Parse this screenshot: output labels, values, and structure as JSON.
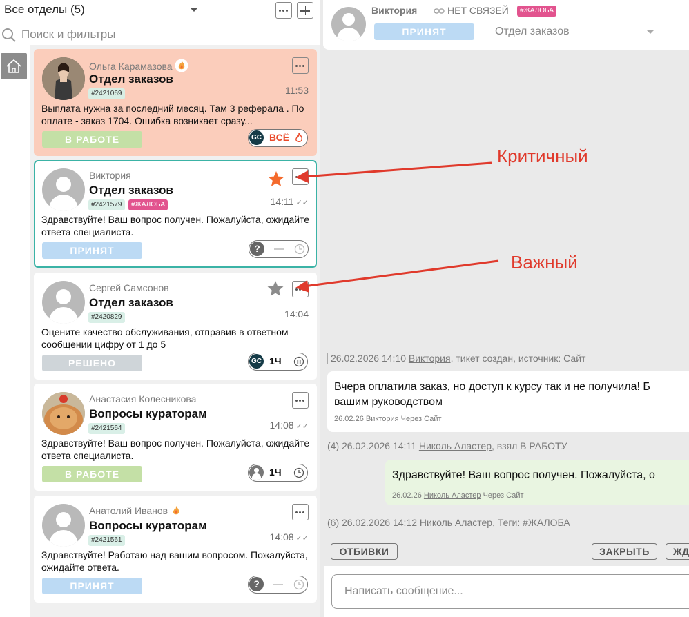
{
  "sidebar": {
    "dept_select": "Все отделы (5)",
    "search_placeholder": "Поиск и фильтры"
  },
  "tickets": [
    {
      "name": "Ольга Карамазова",
      "dept": "Отдел заказов",
      "id": "#2421069",
      "time": "11:53",
      "message": "Выплата нужна за последний месяц. Там 3 реферала . По оплате - заказ 1704. Ошибка возникает сразу...",
      "status": "В РАБОТЕ",
      "pill_badge": "GC",
      "pill_text": "ВСЁ",
      "hot": true,
      "bg_color": "#fbcdbb"
    },
    {
      "name": "Виктория",
      "dept": "Отдел заказов",
      "id": "#2421579",
      "tag": "#ЖАЛОБА",
      "time": "14:11",
      "message": "Здравствуйте! Ваш вопрос получен. Пожалуйста, ожидайте ответа специалиста.",
      "status": "ПРИНЯТ",
      "pill_badge": "?",
      "star_color": "#f46a2c",
      "selected": true
    },
    {
      "name": "Сергей Самсонов",
      "dept": "Отдел заказов",
      "id": "#2420829",
      "time": "14:04",
      "message": "Оцените качество обслуживания, отправив в ответном сообщении цифру от 1 до 5",
      "status": "РЕШЕНО",
      "pill_badge": "GC",
      "pill_text": "1Ч",
      "star_color": "#8c8c8c"
    },
    {
      "name": "Анастасия Колесникова",
      "dept": "Вопросы кураторам",
      "id": "#2421564",
      "time": "14:08",
      "message": "Здравствуйте! Ваш вопрос получен. Пожалуйста, ожидайте ответа специалиста.",
      "status": "В РАБОТЕ",
      "pill_text": "1Ч"
    },
    {
      "name": "Анатолий Иванов",
      "dept": "Вопросы кураторам",
      "id": "#2421561",
      "time": "14:08",
      "message": "Здравствуйте! Работаю над вашим вопросом. Пожалуйста, ожидайте ответа.",
      "status": "ПРИНЯТ",
      "pill_badge": "?",
      "hot": true
    }
  ],
  "chat": {
    "header": {
      "name": "Виктория",
      "no_links": "НЕТ СВЯЗЕЙ",
      "tag": "#ЖАЛОБА",
      "status": "ПРИНЯТ",
      "dept": "Отдел заказов"
    },
    "events": [
      {
        "date": "26.02.2026 14:10",
        "user": "Виктория",
        "text": ", тикет создан, источник: Сайт"
      },
      {
        "prefix": "(4) 26.02.2026 14:11",
        "user": "Николь Аластер",
        "text": ", взял В РАБОТУ"
      },
      {
        "prefix": "(6) 26.02.2026 14:12",
        "user": "Николь Аластер",
        "text": ", Теги: #ЖАЛОБА"
      }
    ],
    "messages": [
      {
        "line1": "Вчера оплатила заказ, но доступ к курсу так и не получила! Б",
        "line2": "вашим руководством",
        "date": "26.02.26",
        "user": "Виктория",
        "source": "Через Сайт"
      },
      {
        "line1": "Здравствуйте! Ваш вопрос получен. Пожалуйста, о",
        "date": "26.02.26",
        "user": "Николь Аластер",
        "source": "Через Сайт"
      }
    ],
    "buttons": {
      "replies": "ОТБИВКИ",
      "close": "ЗАКРЫТЬ",
      "wait": "ЖД"
    },
    "compose_placeholder": "Написать сообщение..."
  },
  "annotations": {
    "critical": "Критичный",
    "important": "Важный",
    "color": "#e03a2c"
  },
  "colors": {
    "accent_teal": "#3bb3a6",
    "status_work": "#c4e0a6",
    "status_accepted": "#bcdaf4",
    "status_done": "#cfd5d9",
    "complaint_tag": "#e2538e"
  }
}
